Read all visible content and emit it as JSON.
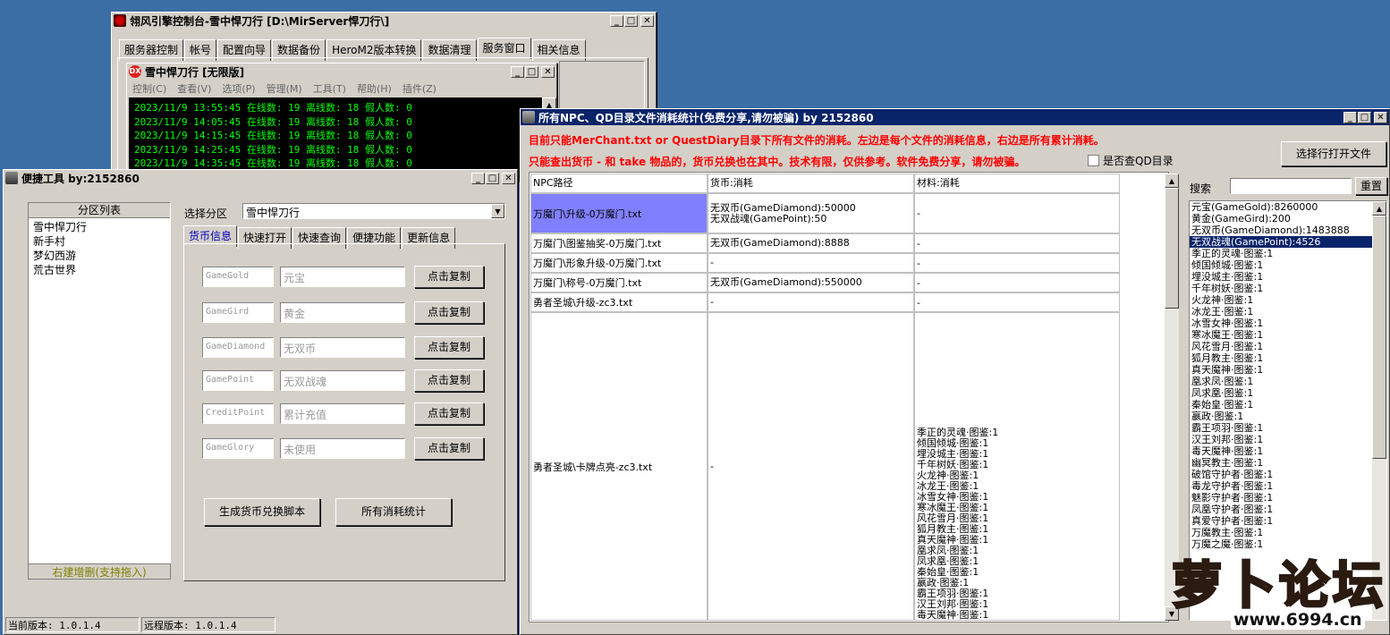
{
  "server_window": {
    "title": "翎风引擎控制台-雪中悍刀行  [D:\\MirServer悍刀行\\]",
    "tabs": [
      "服务器控制",
      "帐号",
      "配置向导",
      "数据备份",
      "HeroM2版本转换",
      "数据清理",
      "服务窗口",
      "相关信息"
    ],
    "active_tab": 6,
    "inner_title": "雪中悍刀行 [无限版]",
    "menu": [
      "控制(C)",
      "查看(V)",
      "选项(P)",
      "管理(M)",
      "工具(T)",
      "帮助(H)",
      "插件(Z)"
    ],
    "log_lines": [
      "2023/11/9 13:55:45 在线数: 19 离线数: 18 假人数: 0",
      "2023/11/9 14:05:45 在线数: 19 离线数: 18 假人数: 0",
      "2023/11/9 14:15:45 在线数: 19 离线数: 18 假人数: 0",
      "2023/11/9 14:25:45 在线数: 19 离线数: 18 假人数: 0",
      "2023/11/9 14:35:45 在线数: 19 离线数: 18 假人数: 0"
    ],
    "log_color": "#00ff00"
  },
  "tool_window": {
    "title": "便捷工具   by:2152860",
    "region_header": "分区列表",
    "regions": [
      "雪中悍刀行",
      "新手村",
      "梦幻西游",
      "荒古世界"
    ],
    "region_footer": "右建增删(支持拖入)",
    "select_label": "选择分区",
    "select_value": "雪中悍刀行",
    "tabs": [
      "货币信息",
      "快速打开",
      "快速查询",
      "便捷功能",
      "更新信息"
    ],
    "active_tab": 0,
    "currency_rows": [
      {
        "key": "GameGold",
        "name": "元宝",
        "button": "点击复制"
      },
      {
        "key": "GameGird",
        "name": "黄金",
        "button": "点击复制"
      },
      {
        "key": "GameDiamond",
        "name": "无双币",
        "button": "点击复制"
      },
      {
        "key": "GamePoint",
        "name": "无双战魂",
        "button": "点击复制"
      },
      {
        "key": "CreditPoint",
        "name": "累计充值",
        "button": "点击复制"
      },
      {
        "key": "GameGlory",
        "name": "未使用",
        "button": "点击复制"
      }
    ],
    "gen_button": "生成货币兑换脚本",
    "stats_button": "所有消耗统计",
    "status_local": "当前版本: 1.0.1.4",
    "status_remote": "远程版本: 1.0.1.4"
  },
  "stats_window": {
    "title": "所有NPC、QD目录文件消耗统计(免费分享,请勿被骗)      by 2152860",
    "notice1": "目前只能MerChant.txt or QuestDiary目录下所有文件的消耗。左边是每个文件的消耗信息，右边是所有累计消耗。",
    "notice2": "只能查出货币 - 和 take 物品的，货币兑换也在其中。技术有限，仅供参考。软件免费分享，请勿被骗。",
    "checkbox_label": "是否查QD目录",
    "open_button": "选择行打开文件",
    "search_label": "搜索",
    "reset_button": "重置",
    "columns": [
      "NPC路径",
      "货币:消耗",
      "材料:消耗"
    ],
    "rows": [
      {
        "path": "万魔门\\升级-0万魔门.txt",
        "currency": [
          "无双币(GameDiamond):50000",
          "无双战魂(GamePoint):50"
        ],
        "material": "-"
      },
      {
        "path": "万魔门\\图鉴抽奖-0万魔门.txt",
        "currency": [
          "无双币(GameDiamond):8888"
        ],
        "material": "-"
      },
      {
        "path": "万魔门\\形象升级-0万魔门.txt",
        "currency": [
          "-"
        ],
        "material": "-"
      },
      {
        "path": "万魔门\\称号-0万魔门.txt",
        "currency": [
          "无双币(GameDiamond):550000"
        ],
        "material": "-"
      },
      {
        "path": "勇者圣城\\升级-zc3.txt",
        "currency": [
          "-"
        ],
        "material": "-"
      },
      {
        "path": "勇者圣城\\卡牌点亮-zc3.txt",
        "currency": [
          "-"
        ],
        "material": ""
      }
    ],
    "materials_list": [
      "季正的灵魂·图鉴:1",
      "倾国倾城·图鉴:1",
      "埋没城主·图鉴:1",
      "千年树妖·图鉴:1",
      "火龙神·图鉴:1",
      "冰龙王·图鉴:1",
      "冰雪女神·图鉴:1",
      "寒冰魔王·图鉴:1",
      "风花雪月·图鉴:1",
      "狐月教主·图鉴:1",
      "真天魔神·图鉴:1",
      "凰求凤·图鉴:1",
      "凤求凰·图鉴:1",
      "秦始皇·图鉴:1",
      "嬴政·图鉴:1",
      "霸王项羽·图鉴:1",
      "汉王刘邦·图鉴:1",
      "毒天魔神·图鉴:1"
    ],
    "totals": [
      "元宝(GameGold):8260000",
      "黄金(GameGird):200",
      "无双币(GameDiamond):1483888",
      "无双战魂(GamePoint):4526",
      "季正的灵魂·图鉴:1",
      "倾国倾城·图鉴:1",
      "埋没城主·图鉴:1",
      "千年树妖·图鉴:1",
      "火龙神·图鉴:1",
      "冰龙王·图鉴:1",
      "冰雪女神·图鉴:1",
      "寒冰魔王·图鉴:1",
      "风花雪月·图鉴:1",
      "狐月教主·图鉴:1",
      "真天魔神·图鉴:1",
      "凰求凤·图鉴:1",
      "凤求凰·图鉴:1",
      "秦始皇·图鉴:1",
      "嬴政·图鉴:1",
      "霸王项羽·图鉴:1",
      "汉王刘邦·图鉴:1",
      "毒天魔神·图鉴:1",
      "幽冥教主·图鉴:1",
      "破馆守护者·图鉴:1",
      "毒龙守护者·图鉴:1",
      "魅影守护者·图鉴:1",
      "凤凰守护者·图鉴:1",
      "真爱守护者·图鉴:1",
      "万魔教主·图鉴:1",
      "万魔之魔·图鉴:1"
    ],
    "totals_selected": 3,
    "notice_color": "#ff0000",
    "highlight_color": "#8080ff"
  },
  "watermark": {
    "brand": "萝卜论坛",
    "site": "www.6994.cn"
  }
}
